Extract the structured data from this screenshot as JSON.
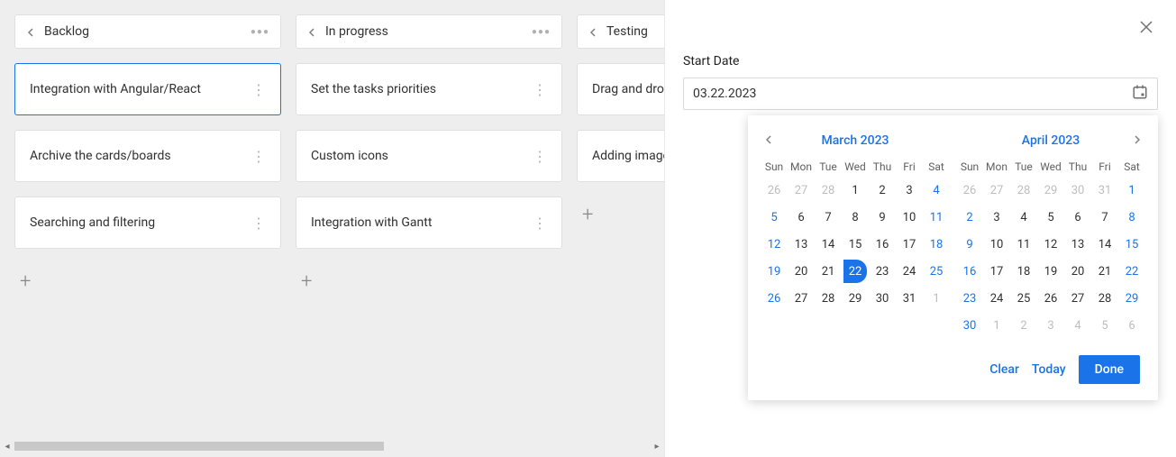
{
  "board": {
    "columns": [
      {
        "title": "Backlog",
        "cards": [
          {
            "title": "Integration with Angular/React",
            "selected": true
          },
          {
            "title": "Archive the cards/boards"
          },
          {
            "title": "Searching and filtering"
          }
        ],
        "show_add": true
      },
      {
        "title": "In progress",
        "cards": [
          {
            "title": "Set the tasks priorities"
          },
          {
            "title": "Custom icons"
          },
          {
            "title": "Integration with Gantt"
          }
        ],
        "show_add": true
      },
      {
        "title": "Testing",
        "cards": [
          {
            "title": "Drag and drop the cards"
          },
          {
            "title": "Adding images"
          }
        ],
        "show_add": true,
        "partial": true
      }
    ]
  },
  "panel": {
    "field_label": "Start Date",
    "date_value": "03.22.2023"
  },
  "calendar": {
    "dow": [
      "Sun",
      "Mon",
      "Tue",
      "Wed",
      "Thu",
      "Fri",
      "Sat"
    ],
    "months": [
      {
        "title": "March 2023",
        "nav": "left",
        "weeks": [
          [
            {
              "n": "26",
              "m": true
            },
            {
              "n": "27",
              "m": true
            },
            {
              "n": "28",
              "m": true
            },
            {
              "n": "1"
            },
            {
              "n": "2"
            },
            {
              "n": "3"
            },
            {
              "n": "4",
              "w": true
            }
          ],
          [
            {
              "n": "5",
              "w": true
            },
            {
              "n": "6"
            },
            {
              "n": "7"
            },
            {
              "n": "8"
            },
            {
              "n": "9"
            },
            {
              "n": "10"
            },
            {
              "n": "11",
              "w": true
            }
          ],
          [
            {
              "n": "12",
              "w": true
            },
            {
              "n": "13"
            },
            {
              "n": "14"
            },
            {
              "n": "15"
            },
            {
              "n": "16"
            },
            {
              "n": "17"
            },
            {
              "n": "18",
              "w": true
            }
          ],
          [
            {
              "n": "19",
              "w": true
            },
            {
              "n": "20"
            },
            {
              "n": "21"
            },
            {
              "n": "22",
              "sel": true
            },
            {
              "n": "23"
            },
            {
              "n": "24"
            },
            {
              "n": "25",
              "w": true
            }
          ],
          [
            {
              "n": "26",
              "w": true
            },
            {
              "n": "27"
            },
            {
              "n": "28"
            },
            {
              "n": "29"
            },
            {
              "n": "30"
            },
            {
              "n": "31"
            },
            {
              "n": "1",
              "m": true
            }
          ]
        ]
      },
      {
        "title": "April 2023",
        "nav": "right",
        "weeks": [
          [
            {
              "n": "26",
              "m": true
            },
            {
              "n": "27",
              "m": true
            },
            {
              "n": "28",
              "m": true
            },
            {
              "n": "29",
              "m": true
            },
            {
              "n": "30",
              "m": true
            },
            {
              "n": "31",
              "m": true
            },
            {
              "n": "1",
              "w": true
            }
          ],
          [
            {
              "n": "2",
              "w": true
            },
            {
              "n": "3"
            },
            {
              "n": "4"
            },
            {
              "n": "5"
            },
            {
              "n": "6"
            },
            {
              "n": "7"
            },
            {
              "n": "8",
              "w": true
            }
          ],
          [
            {
              "n": "9",
              "w": true
            },
            {
              "n": "10"
            },
            {
              "n": "11"
            },
            {
              "n": "12"
            },
            {
              "n": "13"
            },
            {
              "n": "14"
            },
            {
              "n": "15",
              "w": true
            }
          ],
          [
            {
              "n": "16",
              "w": true
            },
            {
              "n": "17"
            },
            {
              "n": "18"
            },
            {
              "n": "19"
            },
            {
              "n": "20"
            },
            {
              "n": "21"
            },
            {
              "n": "22",
              "w": true
            }
          ],
          [
            {
              "n": "23",
              "w": true
            },
            {
              "n": "24"
            },
            {
              "n": "25"
            },
            {
              "n": "26"
            },
            {
              "n": "27"
            },
            {
              "n": "28"
            },
            {
              "n": "29",
              "w": true
            }
          ],
          [
            {
              "n": "30",
              "w": true
            },
            {
              "n": "1",
              "m": true
            },
            {
              "n": "2",
              "m": true
            },
            {
              "n": "3",
              "m": true
            },
            {
              "n": "4",
              "m": true
            },
            {
              "n": "5",
              "m": true
            },
            {
              "n": "6",
              "m": true
            }
          ]
        ]
      }
    ],
    "footer": {
      "clear": "Clear",
      "today": "Today",
      "done": "Done"
    }
  }
}
